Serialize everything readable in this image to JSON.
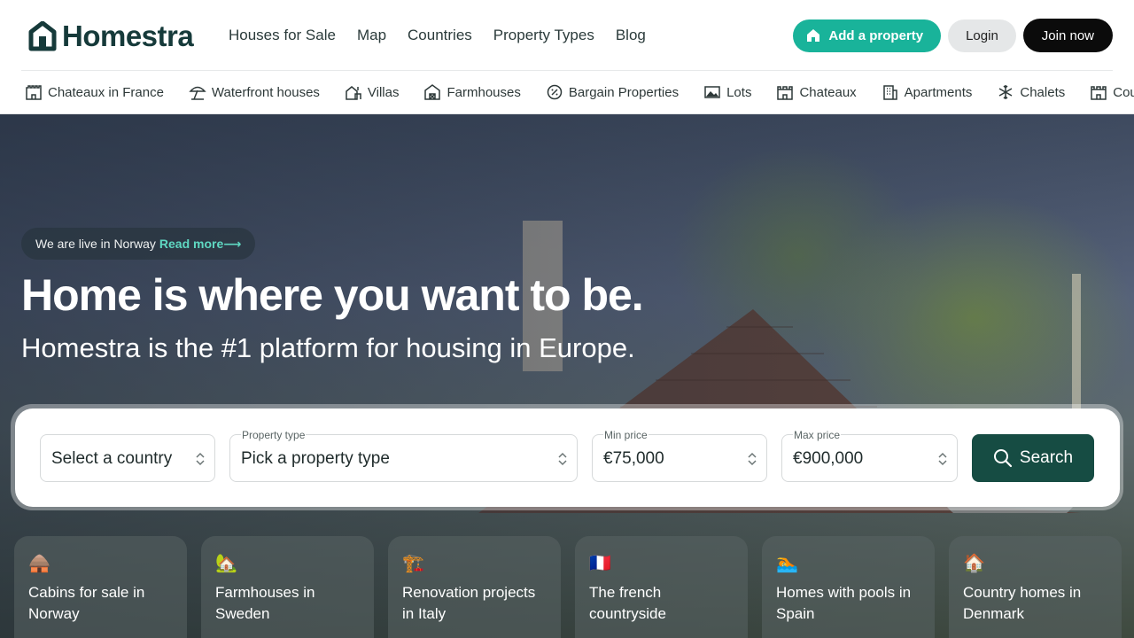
{
  "brand": {
    "name": "Homestra"
  },
  "nav": {
    "items": [
      "Houses for Sale",
      "Map",
      "Countries",
      "Property Types",
      "Blog"
    ]
  },
  "actions": {
    "add_property": "Add a property",
    "login": "Login",
    "join": "Join now"
  },
  "categories": [
    {
      "label": "Chateaux in France",
      "icon": "castle-icon"
    },
    {
      "label": "Waterfront houses",
      "icon": "beach-umbrella-icon"
    },
    {
      "label": "Villas",
      "icon": "villa-icon"
    },
    {
      "label": "Farmhouses",
      "icon": "farmhouse-icon"
    },
    {
      "label": "Bargain Properties",
      "icon": "discount-icon"
    },
    {
      "label": "Lots",
      "icon": "landscape-icon"
    },
    {
      "label": "Chateaux",
      "icon": "castle-icon"
    },
    {
      "label": "Apartments",
      "icon": "building-icon"
    },
    {
      "label": "Chalets",
      "icon": "snowflake-icon"
    },
    {
      "label": "Cou",
      "icon": "castle-icon"
    }
  ],
  "hero": {
    "pill_text": "We are live in Norway",
    "pill_link": "Read more⟶",
    "title": "Home is where you want to be.",
    "subtitle": "Homestra is the #1 platform for housing in Europe."
  },
  "search": {
    "country": {
      "value": "Select a country"
    },
    "property_type": {
      "label": "Property type",
      "value": "Pick a property type"
    },
    "min_price": {
      "label": "Min price",
      "value": "€75,000"
    },
    "max_price": {
      "label": "Max price",
      "value": "€900,000"
    },
    "button": "Search"
  },
  "cards": [
    {
      "emoji": "🛖",
      "title": "Cabins for sale in Norway"
    },
    {
      "emoji": "🏡",
      "title": "Farmhouses in Sweden"
    },
    {
      "emoji": "🏗️",
      "title": "Renovation projects in Italy"
    },
    {
      "emoji": "🇫🇷",
      "title": "The french countryside"
    },
    {
      "emoji": "🏊",
      "title": "Homes with pools in Spain"
    },
    {
      "emoji": "🏠",
      "title": "Country homes in Denmark"
    }
  ],
  "colors": {
    "brand": "#163a3a",
    "accent": "#19b39a",
    "search_button": "#164c43"
  }
}
